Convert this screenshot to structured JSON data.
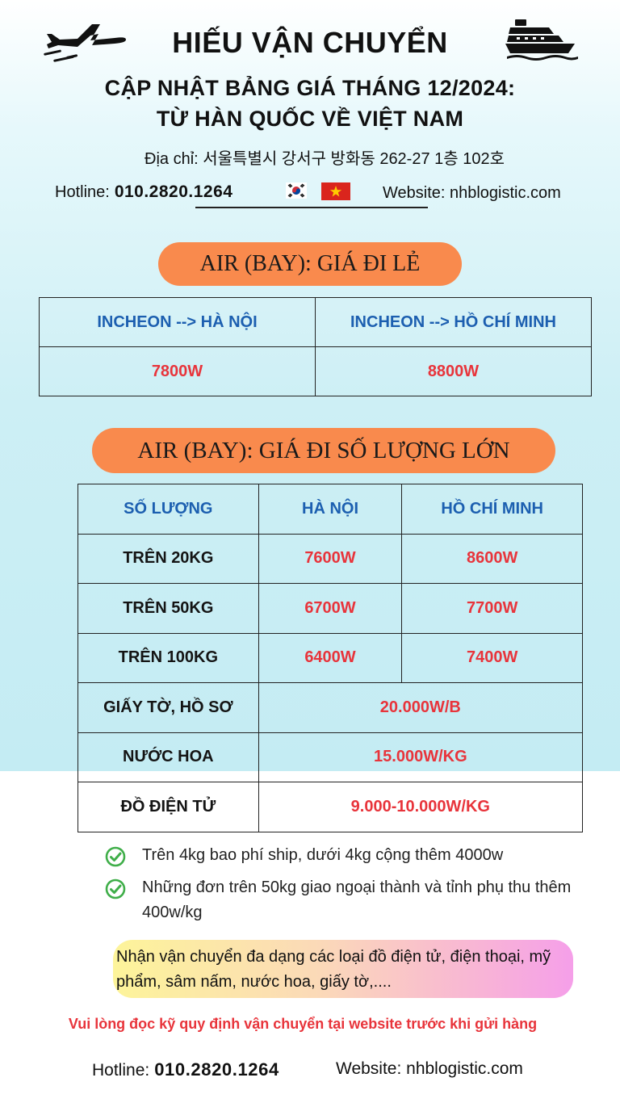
{
  "header": {
    "brand": "HIẾU VẬN CHUYỂN",
    "subtitle_line1": "CẬP NHẬT BẢNG GIÁ THÁNG 12/2024:",
    "subtitle_line2": "TỪ HÀN QUỐC VỀ VIỆT NAM",
    "address": "Địa chỉ: 서울특별시 강서구 방화동 262-27 1층 102호",
    "hotline_label": "Hotline:",
    "hotline_number": "010.2820.1264",
    "website": "Website: nhblogistic.com",
    "icons": [
      "airplane-icon",
      "ship-icon",
      "korea-flag-icon",
      "vietnam-flag-icon"
    ]
  },
  "retail": {
    "title": "AIR (BAY): GIÁ ĐI LẺ",
    "headers": [
      "INCHEON --> HÀ NỘI",
      "INCHEON --> HỒ CHÍ MINH"
    ],
    "prices": [
      "7800W",
      "8800W"
    ]
  },
  "bulk": {
    "title": "AIR (BAY): GIÁ ĐI SỐ LƯỢNG LỚN",
    "headers": [
      "SỐ LƯỢNG",
      "HÀ NỘI",
      "HỒ CHÍ MINH"
    ],
    "rows": [
      {
        "label": "TRÊN 20KG",
        "hanoi": "7600W",
        "hcm": "8600W"
      },
      {
        "label": "TRÊN 50KG",
        "hanoi": "6700W",
        "hcm": "7700W"
      },
      {
        "label": "TRÊN 100KG",
        "hanoi": "6400W",
        "hcm": "7400W"
      }
    ],
    "special": [
      {
        "label": "GIẤY TỜ, HỒ SƠ",
        "price": "20.000W/B"
      },
      {
        "label": "NƯỚC HOA",
        "price": "15.000W/KG"
      },
      {
        "label": "ĐỒ ĐIỆN TỬ",
        "price": "9.000-10.000W/KG"
      }
    ]
  },
  "notes": [
    "Trên 4kg bao phí ship, dưới 4kg cộng thêm 4000w",
    "Những đơn trên 50kg giao ngoại thành và tỉnh phụ thu thêm 400w/kg"
  ],
  "banner": "Nhận vận chuyển đa dạng các loại đồ điện tử, điện thoại, mỹ phẩm, sâm nấm, nước hoa, giấy tờ,....",
  "warning": "Vui lòng đọc kỹ quy định vận chuyển tại website trước khi gửi hàng",
  "footer": {
    "hotline_label": "Hotline:",
    "hotline_number": "010.2820.1264",
    "website": "Website: nhblogistic.com"
  },
  "colors": {
    "accent_orange": "#f98a4d",
    "header_blue": "#1c5fb0",
    "price_red": "#e8343b",
    "check_green": "#3fae49"
  }
}
